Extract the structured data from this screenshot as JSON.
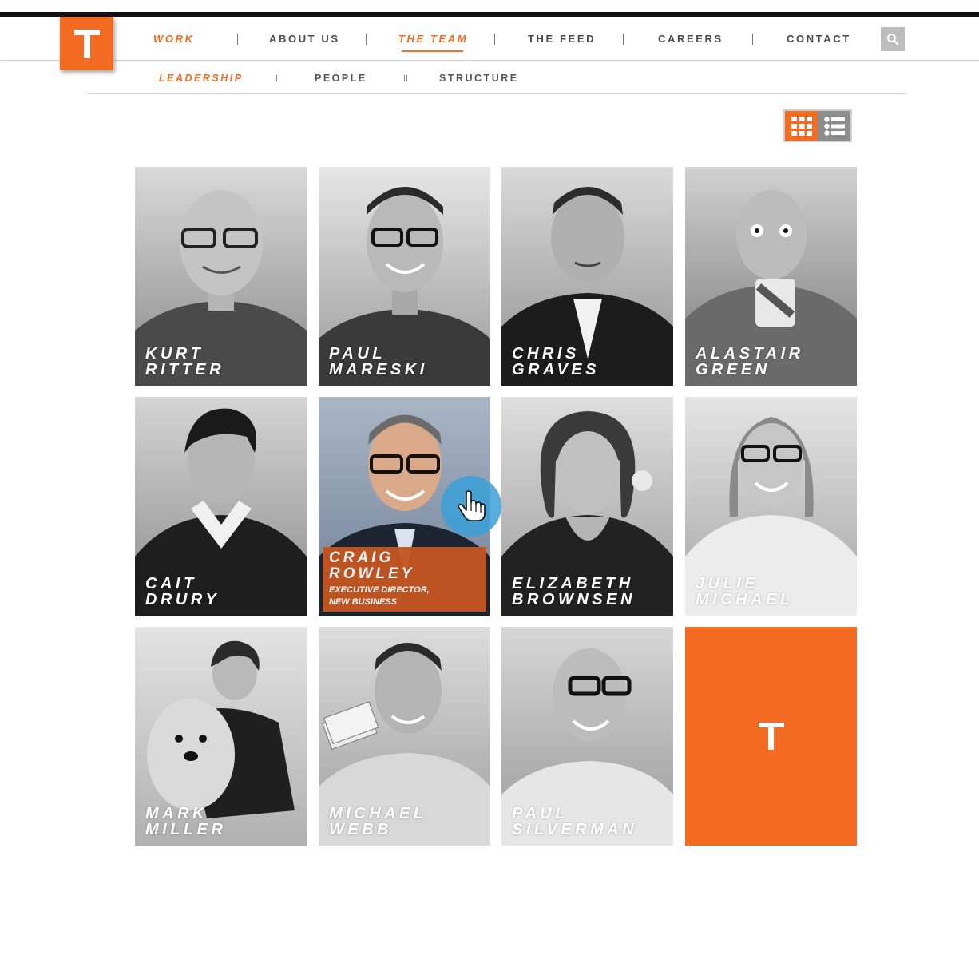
{
  "header": {
    "nav": [
      {
        "label": "WORK"
      },
      {
        "label": "ABOUT US"
      },
      {
        "label": "THE TEAM"
      },
      {
        "label": "THE FEED"
      },
      {
        "label": "CAREERS"
      },
      {
        "label": "CONTACT"
      }
    ],
    "search_icon": "search-icon",
    "colors": {
      "accent": "#f26b21",
      "text": "#4a4a4a"
    }
  },
  "subnav": {
    "items": [
      {
        "label": "LEADERSHIP"
      },
      {
        "label": "PEOPLE"
      },
      {
        "label": "STRUCTURE"
      }
    ],
    "active": "LEADERSHIP"
  },
  "view_toggle": {
    "active": "grid",
    "icons": [
      "grid-icon",
      "list-icon"
    ]
  },
  "team": [
    {
      "first": "KURT",
      "last": "RITTER"
    },
    {
      "first": "PAUL",
      "last": "MARESKI"
    },
    {
      "first": "CHRIS",
      "last": "GRAVES"
    },
    {
      "first": "ALASTAIR",
      "last": "GREEN"
    },
    {
      "first": "CAIT",
      "last": "DRURY"
    },
    {
      "first": "CRAIG",
      "last": "ROWLEY",
      "title_line1": "EXECUTIVE DIRECTOR,",
      "title_line2": "NEW BUSINESS"
    },
    {
      "first": "ELIZABETH",
      "last": "BROWNSEN"
    },
    {
      "first": "JULIE",
      "last": "MICHAEL"
    },
    {
      "first": "MARK",
      "last": "MILLER"
    },
    {
      "first": "MICHAEL",
      "last": "WEBB"
    },
    {
      "first": "PAUL",
      "last": "SILVERMAN"
    }
  ]
}
